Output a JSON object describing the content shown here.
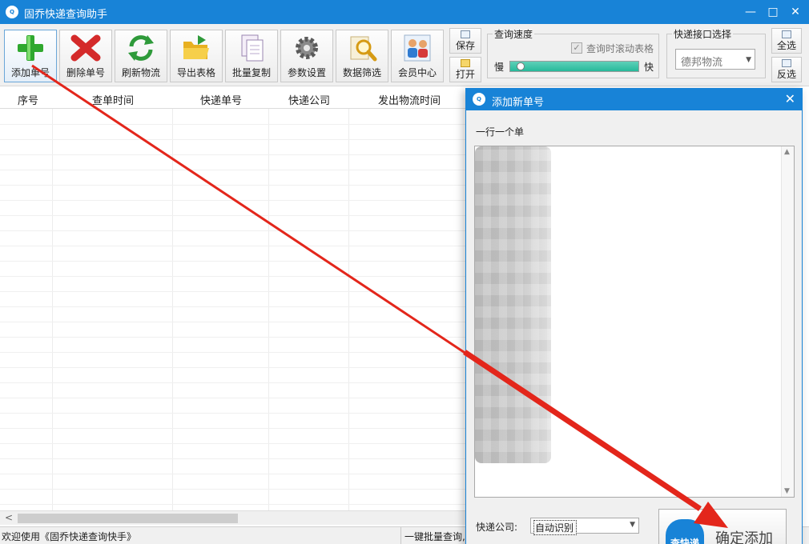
{
  "window": {
    "title": "固乔快递查询助手",
    "minimize": "—",
    "maximize": "□",
    "close": "✕"
  },
  "toolbar": {
    "buttons": [
      {
        "label": "添加单号",
        "icon": "add-icon"
      },
      {
        "label": "删除单号",
        "icon": "delete-icon"
      },
      {
        "label": "刷新物流",
        "icon": "refresh-icon"
      },
      {
        "label": "导出表格",
        "icon": "export-folder-icon"
      },
      {
        "label": "批量复制",
        "icon": "copy-icon"
      },
      {
        "label": "参数设置",
        "icon": "gear-icon"
      },
      {
        "label": "数据筛选",
        "icon": "magnifier-icon"
      },
      {
        "label": "会员中心",
        "icon": "members-icon"
      }
    ],
    "save_label": "保存",
    "open_label": "打开",
    "select_all_label": "全选",
    "invert_label": "反选"
  },
  "speed": {
    "title": "查询速度",
    "scroll_table_label": "查询时滚动表格",
    "scroll_table_checked": true,
    "slow_label": "慢",
    "fast_label": "快",
    "level": 0.05
  },
  "api": {
    "title": "快递接口选择",
    "selected": "德邦物流"
  },
  "table": {
    "columns": [
      "序号",
      "查单时间",
      "快递单号",
      "快递公司",
      "发出物流时间"
    ],
    "rows": []
  },
  "status": {
    "welcome": "欢迎使用《固乔快递查询快手》",
    "hint": "一键批量查询,"
  },
  "dialog": {
    "title": "添加新单号",
    "instruction": "一行一个单",
    "textarea_value": "",
    "company_label": "快递公司:",
    "company_selected": "自动识别",
    "confirm_label": "确定添加",
    "logo_text": "查快递"
  },
  "colors": {
    "title_bar": "#1883d7",
    "annotation_arrow": "#e3261b"
  }
}
